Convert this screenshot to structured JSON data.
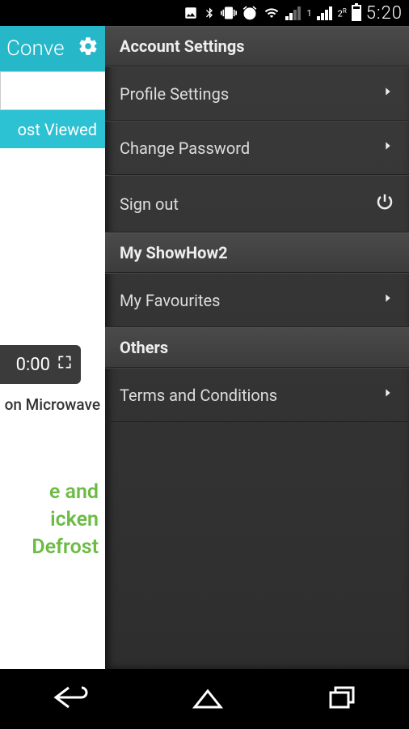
{
  "status": {
    "time": "5:20",
    "signal1_label": "1",
    "signal2_label": "2",
    "signal2_sup": "R"
  },
  "appbar": {
    "title_fragment": "Conve"
  },
  "tabs": {
    "most_viewed": "ost Viewed"
  },
  "video": {
    "duration_fragment": "0:00",
    "caption_fragment": "on Microwave",
    "title_line1": "e and",
    "title_line2": "icken",
    "title_line3": "Defrost"
  },
  "drawer": {
    "sections": {
      "account": "Account Settings",
      "my": "My ShowHow2",
      "others": "Others"
    },
    "items": {
      "profile": "Profile Settings",
      "password": "Change Password",
      "signout": "Sign out",
      "favourites": "My Favourites",
      "terms": "Terms and Conditions"
    }
  }
}
